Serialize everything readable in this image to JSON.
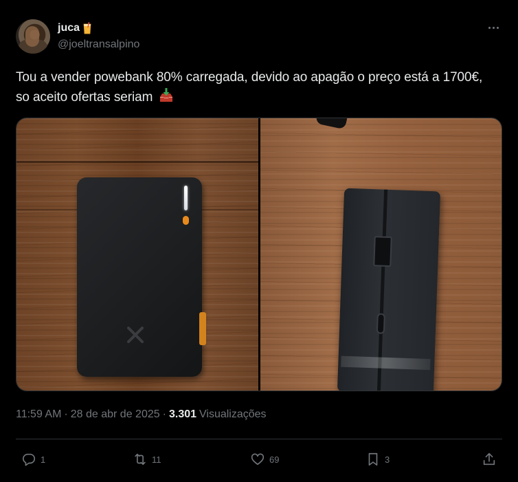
{
  "author": {
    "display_name": "juca",
    "name_emoji_icon": "beverage-glass-icon",
    "handle": "@joeltransalpino"
  },
  "tweet": {
    "text": "Tou a vender powebank 80% carregada, devido ao apagão o preço está a 1700€, so aceito ofertas seriam",
    "text_emoji_icon": "inbox-tray-icon"
  },
  "media": {
    "photos": [
      "powerbank-front-photo",
      "powerbank-side-photo"
    ]
  },
  "meta": {
    "time": "11:59 AM",
    "separator": "·",
    "date": "28 de abr de 2025",
    "views_count": "3.301",
    "views_label": "Visualizações"
  },
  "actions": {
    "reply_count": "1",
    "retweet_count": "11",
    "like_count": "69",
    "bookmark_count": "3"
  },
  "colors": {
    "background": "#000000",
    "text_primary": "#e7e9ea",
    "text_secondary": "#71767b",
    "border": "#2f3336"
  }
}
